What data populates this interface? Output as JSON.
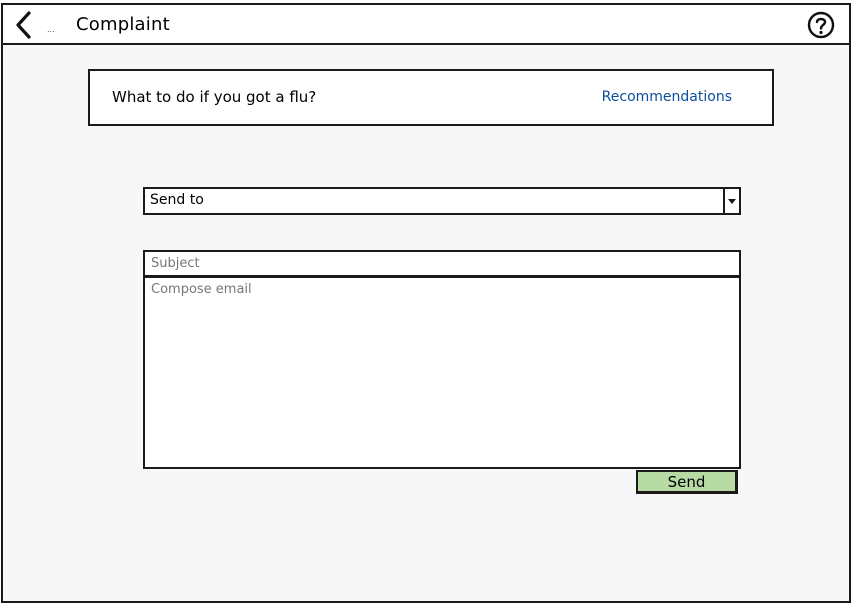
{
  "header": {
    "title": "Complaint",
    "back_icon": "chevron-left-icon",
    "help_icon": "question-circle-icon"
  },
  "notice": {
    "text": "What to do if you got a flu?",
    "link_label": "Recommendations",
    "link_color": "#0a4f9e"
  },
  "form": {
    "send_to_value": "Send to",
    "subject_placeholder": "Subject",
    "compose_placeholder": "Compose email",
    "send_label": "Send",
    "send_color": "#b8dba6"
  }
}
